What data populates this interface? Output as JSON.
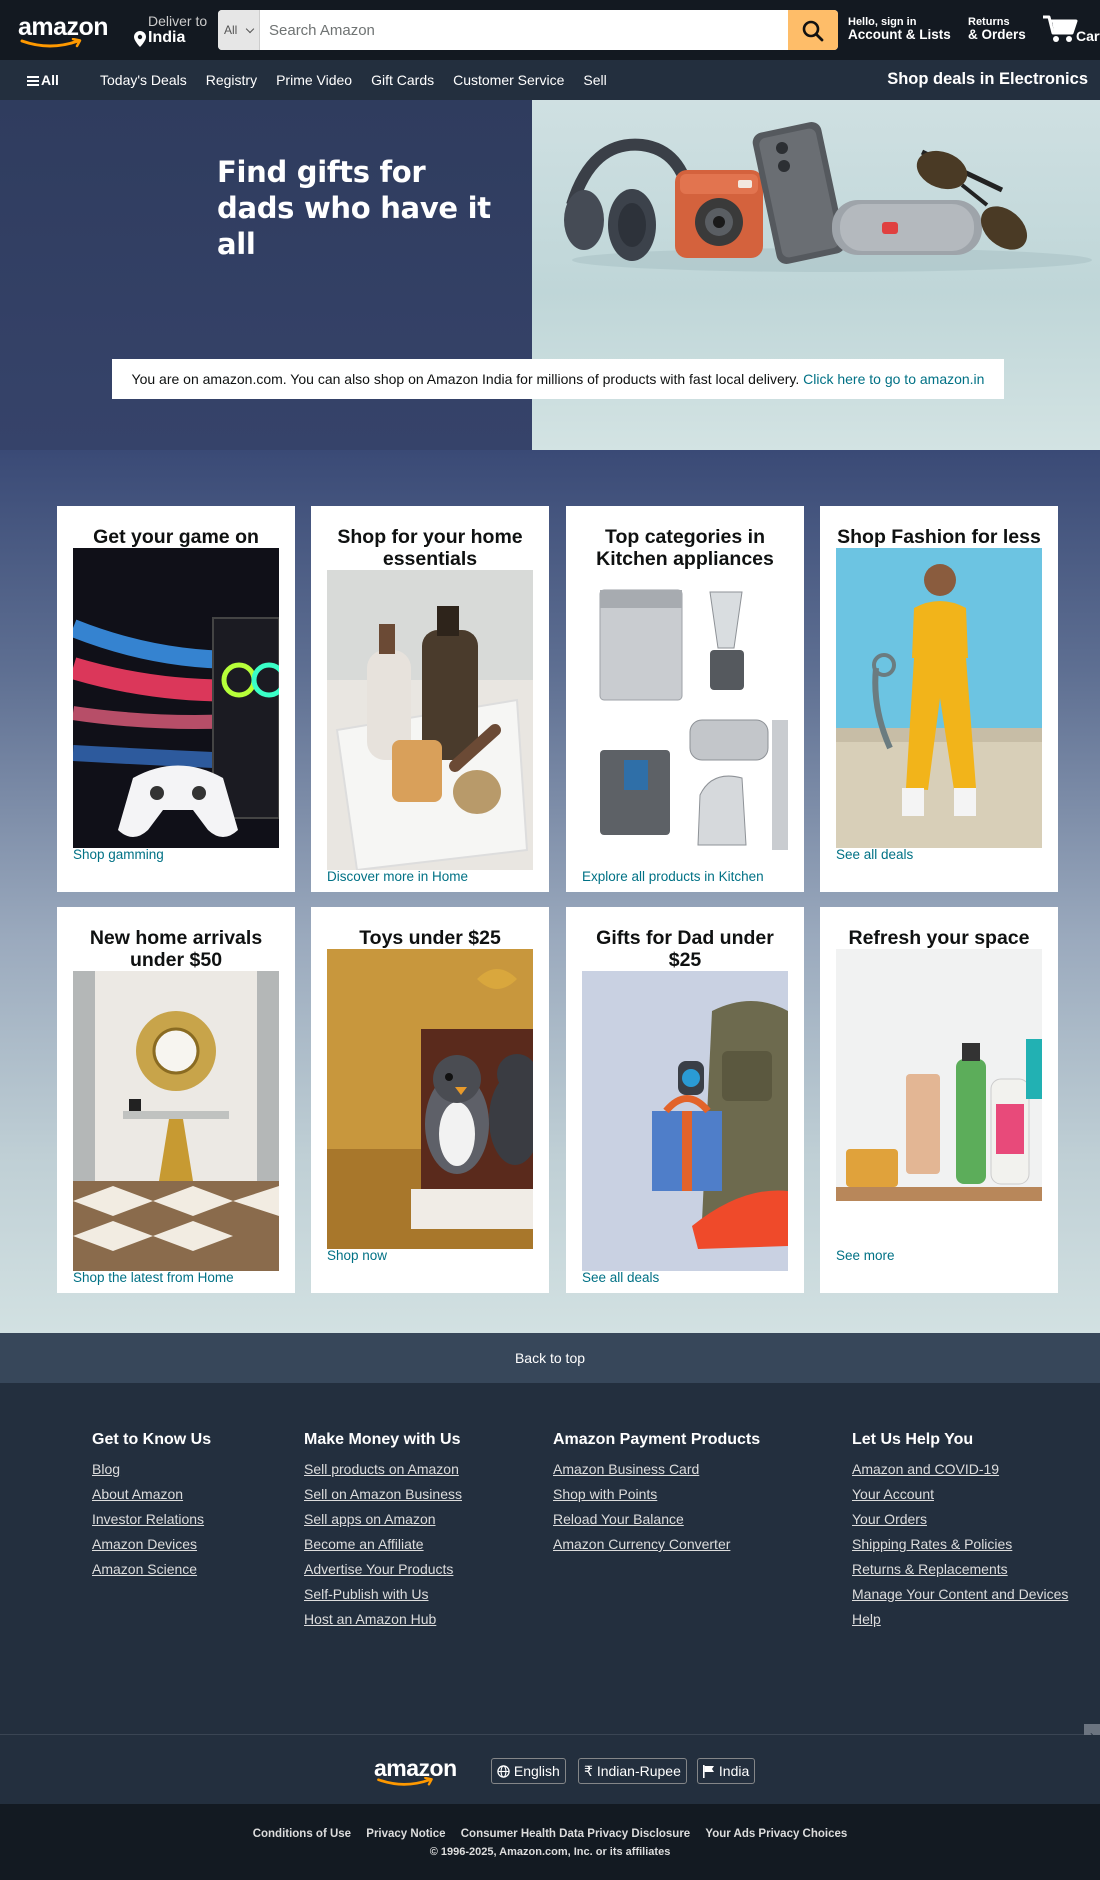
{
  "header": {
    "logo_text": "amazon",
    "deliver_label": "Deliver to",
    "deliver_location": "India",
    "search_category": "All",
    "search_placeholder": "Search Amazon",
    "account_line1": "Hello, sign in",
    "account_line2": "Account & Lists",
    "orders_line1": "Returns",
    "orders_line2": "& Orders",
    "cart_label": "Cart"
  },
  "subnav": {
    "all_label": "All",
    "links": [
      "Today's Deals",
      "Registry",
      "Prime Video",
      "Gift Cards",
      "Customer Service",
      "Sell"
    ],
    "promo": "Shop deals in Electronics"
  },
  "hero": {
    "title_line1": "Find gifts for",
    "title_line2": "dads who have it all",
    "banner_text": "You are on amazon.com. You can also shop on Amazon India for millions of products with fast local delivery.",
    "banner_link": "Click here to go to amazon.in"
  },
  "cards": [
    {
      "title": "Get your game on",
      "link": "Shop gamming"
    },
    {
      "title": "Shop for your home essentials",
      "link": "Discover more in Home"
    },
    {
      "title": "Top categories in Kitchen appliances",
      "link": "Explore all products in Kitchen"
    },
    {
      "title": "Shop Fashion for less",
      "link": "See all deals"
    },
    {
      "title": "New home arrivals under $50",
      "link": "Shop the latest from Home"
    },
    {
      "title": "Toys under $25",
      "link": "Shop now"
    },
    {
      "title": "Gifts for Dad under $25",
      "link": "See all deals"
    },
    {
      "title": "Refresh your space",
      "link": "See more"
    }
  ],
  "footer": {
    "back_to_top": "Back to top",
    "columns": [
      {
        "heading": "Get to Know Us",
        "links": [
          "Blog",
          "About Amazon",
          "Investor Relations",
          "Amazon Devices",
          "Amazon Science"
        ]
      },
      {
        "heading": "Make Money with Us",
        "links": [
          "Sell products on Amazon",
          "Sell on Amazon Business",
          "Sell apps on Amazon",
          "Become an Affiliate",
          "Advertise Your Products",
          "Self-Publish with Us",
          "Host an Amazon Hub"
        ]
      },
      {
        "heading": "Amazon Payment Products",
        "links": [
          "Amazon Business Card",
          "Shop with Points",
          "Reload Your Balance",
          "Amazon Currency Converter"
        ]
      },
      {
        "heading": "Let Us Help You",
        "links": [
          "Amazon and COVID-19",
          "Your Account",
          "Your Orders",
          "Shipping Rates & Policies",
          "Returns & Replacements",
          "Manage Your Content and Devices",
          "Help"
        ]
      }
    ],
    "language": "English",
    "currency": "Indian-Rupee",
    "country": "India",
    "legal_links": [
      "Conditions of Use",
      "Privacy Notice",
      "Consumer Health Data Privacy Disclosure",
      "Your Ads Privacy Choices"
    ],
    "copyright": "© 1996-2025, Amazon.com, Inc. or its affiliates"
  },
  "colors": {
    "nav_dark": "#131921",
    "nav_sub": "#232f3e",
    "search_button": "#febd69",
    "link": "#007185",
    "logo_smile": "#ff9900"
  }
}
